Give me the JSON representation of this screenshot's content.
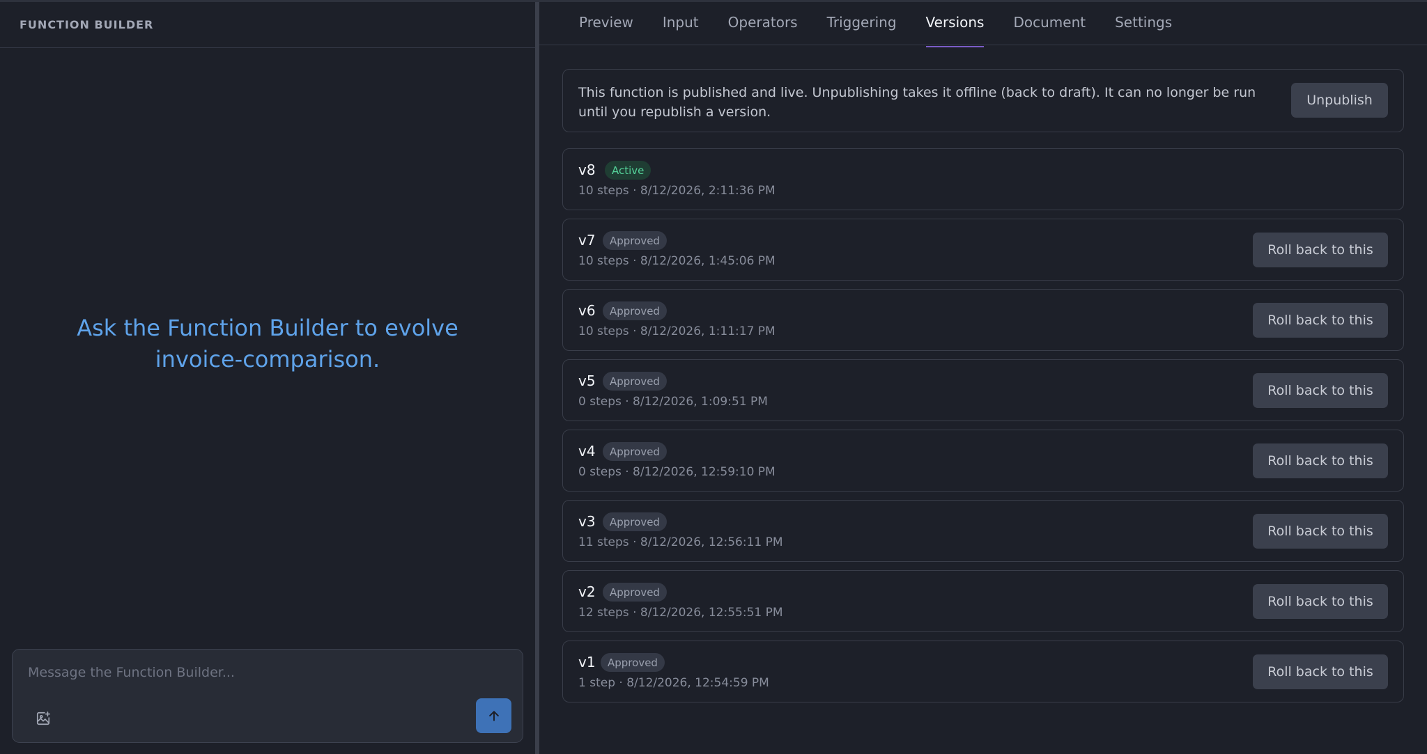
{
  "left_panel": {
    "title": "FUNCTION BUILDER",
    "prompt": "Ask the Function Builder to evolve invoice-comparison.",
    "composer": {
      "placeholder": "Message the Function Builder...",
      "value": ""
    },
    "icons": {
      "attach": "image-plus-icon",
      "send": "arrow-up-icon"
    },
    "colors": {
      "send_button": "#3e72b7",
      "prompt_text": "#5fa3ea"
    }
  },
  "tabs": [
    {
      "label": "Preview"
    },
    {
      "label": "Input"
    },
    {
      "label": "Operators"
    },
    {
      "label": "Triggering"
    },
    {
      "label": "Versions",
      "active": true
    },
    {
      "label": "Document"
    },
    {
      "label": "Settings"
    }
  ],
  "notice": {
    "text": "This function is published and live. Unpublishing takes it offline (back to draft). It can no longer be run until you republish a version.",
    "button_label": "Unpublish"
  },
  "versions": [
    {
      "name": "v8",
      "status": "Active",
      "meta": "10 steps · 8/12/2026, 2:11:36 PM",
      "rollback_label": ""
    },
    {
      "name": "v7",
      "status": "Approved",
      "meta": "10 steps · 8/12/2026, 1:45:06 PM",
      "rollback_label": "Roll back to this"
    },
    {
      "name": "v6",
      "status": "Approved",
      "meta": "10 steps · 8/12/2026, 1:11:17 PM",
      "rollback_label": "Roll back to this"
    },
    {
      "name": "v5",
      "status": "Approved",
      "meta": "0 steps · 8/12/2026, 1:09:51 PM",
      "rollback_label": "Roll back to this"
    },
    {
      "name": "v4",
      "status": "Approved",
      "meta": "0 steps · 8/12/2026, 12:59:10 PM",
      "rollback_label": "Roll back to this"
    },
    {
      "name": "v3",
      "status": "Approved",
      "meta": "11 steps · 8/12/2026, 12:56:11 PM",
      "rollback_label": "Roll back to this"
    },
    {
      "name": "v2",
      "status": "Approved",
      "meta": "12 steps · 8/12/2026, 12:55:51 PM",
      "rollback_label": "Roll back to this"
    },
    {
      "name": "v1",
      "status": "Approved",
      "meta": "1 step · 8/12/2026, 12:54:59 PM",
      "rollback_label": "Roll back to this"
    }
  ],
  "status_colors": {
    "active_bg": "#1f3d33",
    "active_text": "#55d39a",
    "approved_bg": "#343946",
    "approved_text": "#9aa0ae"
  }
}
